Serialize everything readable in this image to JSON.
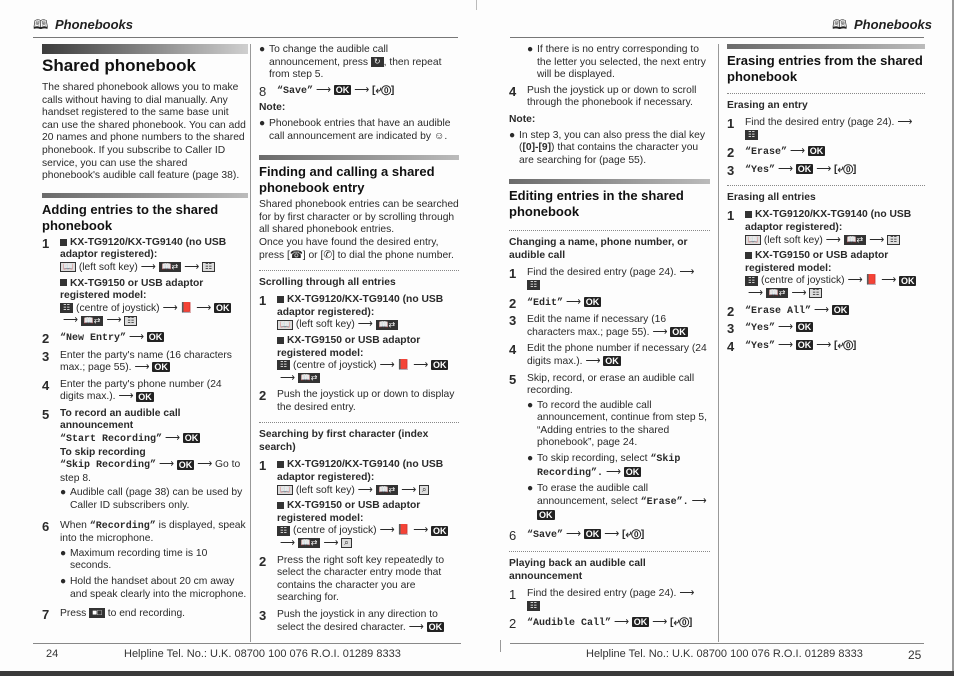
{
  "header": {
    "left_title": "Phonebooks",
    "right_title": "Phonebooks",
    "book_icon": "🕮"
  },
  "symbols": {
    "arrow": "⟶",
    "ok": "OK",
    "off_key": "[⤶⓪]",
    "bullet": "●"
  },
  "col1": {
    "title": "Shared phonebook",
    "intro": "The shared phonebook allows you to make calls without having to dial manually. Any handset registered to the same base unit can use the shared phonebook. You can add 20 names and phone numbers to the shared phonebook. If you subscribe to Caller ID service, you can use the shared phonebook's audible call feature (page 38).",
    "section_title": "Adding entries to the shared phonebook",
    "step1_num": "1",
    "model_a": "KX-TG9120/KX-TG9140 (no USB adaptor registered):",
    "model_a_path": "(left soft key)",
    "model_b": "KX-TG9150 or USB adaptor registered model:",
    "model_b_path": "(centre of joystick)",
    "step2_num": "2",
    "step2": "“New Entry”",
    "step3_num": "3",
    "step3": "Enter the party's name (16 characters max.; page 55).",
    "step4_num": "4",
    "step4": "Enter the party's phone number (24 digits max.).",
    "step5_num": "5",
    "step5_title": "To record an audible call announcement",
    "step5_start": "“Start Recording”",
    "step5_skip_title": "To skip recording",
    "step5_skip": "“Skip Recording”",
    "step5_goto": "Go to step 8.",
    "step5_bullet": "Audible call (page 38) can be used by Caller ID subscribers only.",
    "step6_num": "6",
    "step6_pre": "When",
    "step6_mono": "“Recording”",
    "step6_post": "is displayed, speak into the microphone.",
    "step6_bullet1": "Maximum recording time is 10 seconds.",
    "step6_bullet2": "Hold the handset about 20 cm away and speak clearly into the microphone.",
    "step7_num": "7",
    "step7_pre": "Press",
    "step7_post": "to end recording."
  },
  "col2": {
    "bullet_change_pre": "To change the audible call announcement, press",
    "bullet_change_post": ", then repeat from step 5.",
    "step8_num": "8",
    "step8": "“Save”",
    "note_label": "Note:",
    "note_text": "Phonebook entries that have an audible call announcement are indicated by ☺.",
    "section_title": "Finding and calling a shared phonebook entry",
    "intro1": "Shared phonebook entries can be searched for by first character or by scrolling through all shared phonebook entries.",
    "intro2": "Once you have found the desired entry, press [☎] or [✆] to dial the phone number.",
    "scroll_title": "Scrolling through all entries",
    "s1_num": "1",
    "s1_model_a": "KX-TG9120/KX-TG9140 (no USB adaptor registered):",
    "s1_path_a": "(left soft key)",
    "s1_model_b": "KX-TG9150 or USB adaptor registered model:",
    "s1_path_b": "(centre of joystick)",
    "s2_num": "2",
    "s2": "Push the joystick up or down to display the desired entry.",
    "index_title": "Searching by first character (index search)",
    "i1_num": "1",
    "i1_model_a": "KX-TG9120/KX-TG9140 (no USB adaptor registered):",
    "i1_path_a": "(left soft key)",
    "i1_model_b": "KX-TG9150 or USB adaptor registered model:",
    "i1_path_b": "(centre of joystick)",
    "i2_num": "2",
    "i2": "Press the right soft key repeatedly to select the character entry mode that contains the character you are searching for.",
    "i3_num": "3",
    "i3": "Push the joystick in any direction to select the desired character."
  },
  "col3": {
    "bullet_noentry": "If there is no entry corresponding to the letter you selected, the next entry will be displayed.",
    "step4_num": "4",
    "step4": "Push the joystick up or down to scroll through the phonebook if necessary.",
    "note_label": "Note:",
    "note_pre": "In step 3, you can also press the dial key (",
    "note_keys": "[0]-[9]",
    "note_post": ") that contains the character you are searching for (page 55).",
    "section_title": "Editing entries in the shared phonebook",
    "change_title": "Changing a name, phone number, or audible call",
    "c1_num": "1",
    "c1": "Find the desired entry (page 24).",
    "c2_num": "2",
    "c2": "“Edit”",
    "c3_num": "3",
    "c3": "Edit the name if necessary (16 characters max.; page 55).",
    "c4_num": "4",
    "c4": "Edit the phone number if necessary (24 digits max.).",
    "c5_num": "5",
    "c5": "Skip, record, or erase an audible call recording.",
    "c5_b1": "To record the audible call announcement, continue from step 5, “Adding entries to the shared phonebook”, page 24.",
    "c5_b2_pre": "To skip recording, select",
    "c5_b2_mono": "“Skip Recording”.",
    "c5_b3_pre": "To erase the audible call announcement, select",
    "c5_b3_mono": "“Erase”.",
    "c6_num": "6",
    "c6": "“Save”",
    "play_title": "Playing back an audible call announcement",
    "p1_num": "1",
    "p1": "Find the desired entry (page 24).",
    "p2_num": "2",
    "p2": "“Audible Call”"
  },
  "col4": {
    "section_title": "Erasing entries from the shared phonebook",
    "one_title": "Erasing an entry",
    "e1_num": "1",
    "e1": "Find the desired entry (page 24).",
    "e2_num": "2",
    "e2": "“Erase”",
    "e3_num": "3",
    "e3": "“Yes”",
    "all_title": "Erasing all entries",
    "a1_num": "1",
    "a1_model_a": "KX-TG9120/KX-TG9140 (no USB adaptor registered):",
    "a1_path_a": "(left soft key)",
    "a1_model_b": "KX-TG9150 or USB adaptor registered model:",
    "a1_path_b": "(centre of joystick)",
    "a2_num": "2",
    "a2": "“Erase All”",
    "a3_num": "3",
    "a3": "“Yes”",
    "a4_num": "4",
    "a4": "“Yes”"
  },
  "footer": {
    "left_page": "24",
    "right_page": "25",
    "helpline_left": "Helpline Tel. No.: U.K. 08700 100 076  R.O.I. 01289 8333",
    "helpline_right": "Helpline Tel. No.: U.K. 08700 100 076  R.O.I. 01289 8333"
  }
}
